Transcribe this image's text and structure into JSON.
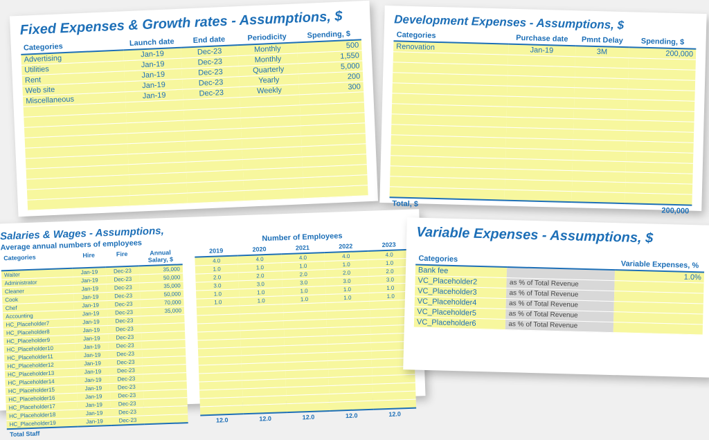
{
  "fixed": {
    "title": "Fixed Expenses & Growth rates - Assumptions, $",
    "headers": [
      "Categories",
      "Launch date",
      "End date",
      "Periodicity",
      "Spending, $"
    ],
    "rows": [
      {
        "cat": "Advertising",
        "launch": "Jan-19",
        "end": "Dec-23",
        "per": "Monthly",
        "spend": "500"
      },
      {
        "cat": "Utilities",
        "launch": "Jan-19",
        "end": "Dec-23",
        "per": "Monthly",
        "spend": "1,550"
      },
      {
        "cat": "Rent",
        "launch": "Jan-19",
        "end": "Dec-23",
        "per": "Quarterly",
        "spend": "5,000"
      },
      {
        "cat": "Web site",
        "launch": "Jan-19",
        "end": "Dec-23",
        "per": "Yearly",
        "spend": "200"
      },
      {
        "cat": "Miscellaneous",
        "launch": "Jan-19",
        "end": "Dec-23",
        "per": "Weekly",
        "spend": "300"
      }
    ],
    "blank_rows": 10
  },
  "dev": {
    "title": "Development Expenses - Assumptions, $",
    "headers": [
      "Categories",
      "Purchase date",
      "Pmnt Delay",
      "Spending, $"
    ],
    "rows": [
      {
        "cat": "Renovation",
        "date": "Jan-19",
        "delay": "3M",
        "spend": "200,000"
      }
    ],
    "blank_rows": 14,
    "total_label": "Total, $",
    "total_value": "200,000"
  },
  "sal": {
    "title": "Salaries & Wages - Assumptions,",
    "subtitle": "Average annual numbers of employees",
    "emp_title": "Number of Employees",
    "headers_left": [
      "Categories",
      "Hire",
      "Fire",
      "Annual Salary, $"
    ],
    "years": [
      "2019",
      "2020",
      "2021",
      "2022",
      "2023"
    ],
    "rows": [
      {
        "cat": "Waiter",
        "hire": "Jan-19",
        "fire": "Dec-23",
        "sal": "35,000",
        "y": [
          "4.0",
          "4.0",
          "4.0",
          "4.0",
          "4.0"
        ]
      },
      {
        "cat": "Administrator",
        "hire": "Jan-19",
        "fire": "Dec-23",
        "sal": "50,000",
        "y": [
          "1.0",
          "1.0",
          "1.0",
          "1.0",
          "1.0"
        ]
      },
      {
        "cat": "Cleaner",
        "hire": "Jan-19",
        "fire": "Dec-23",
        "sal": "35,000",
        "y": [
          "2.0",
          "2.0",
          "2.0",
          "2.0",
          "2.0"
        ]
      },
      {
        "cat": "Cook",
        "hire": "Jan-19",
        "fire": "Dec-23",
        "sal": "50,000",
        "y": [
          "3.0",
          "3.0",
          "3.0",
          "3.0",
          "3.0"
        ]
      },
      {
        "cat": "Chef",
        "hire": "Jan-19",
        "fire": "Dec-23",
        "sal": "70,000",
        "y": [
          "1.0",
          "1.0",
          "1.0",
          "1.0",
          "1.0"
        ]
      },
      {
        "cat": "Accounting",
        "hire": "Jan-19",
        "fire": "Dec-23",
        "sal": "35,000",
        "y": [
          "1.0",
          "1.0",
          "1.0",
          "1.0",
          "1.0"
        ]
      },
      {
        "cat": "HC_Placeholder7",
        "hire": "Jan-19",
        "fire": "Dec-23",
        "sal": "",
        "y": [
          "",
          "",
          "",
          "",
          ""
        ]
      },
      {
        "cat": "HC_Placeholder8",
        "hire": "Jan-19",
        "fire": "Dec-23",
        "sal": "",
        "y": [
          "",
          "",
          "",
          "",
          ""
        ]
      },
      {
        "cat": "HC_Placeholder9",
        "hire": "Jan-19",
        "fire": "Dec-23",
        "sal": "",
        "y": [
          "",
          "",
          "",
          "",
          ""
        ]
      },
      {
        "cat": "HC_Placeholder10",
        "hire": "Jan-19",
        "fire": "Dec-23",
        "sal": "",
        "y": [
          "",
          "",
          "",
          "",
          ""
        ]
      },
      {
        "cat": "HC_Placeholder11",
        "hire": "Jan-19",
        "fire": "Dec-23",
        "sal": "",
        "y": [
          "",
          "",
          "",
          "",
          ""
        ]
      },
      {
        "cat": "HC_Placeholder12",
        "hire": "Jan-19",
        "fire": "Dec-23",
        "sal": "",
        "y": [
          "",
          "",
          "",
          "",
          ""
        ]
      },
      {
        "cat": "HC_Placeholder13",
        "hire": "Jan-19",
        "fire": "Dec-23",
        "sal": "",
        "y": [
          "",
          "",
          "",
          "",
          ""
        ]
      },
      {
        "cat": "HC_Placeholder14",
        "hire": "Jan-19",
        "fire": "Dec-23",
        "sal": "",
        "y": [
          "",
          "",
          "",
          "",
          ""
        ]
      },
      {
        "cat": "HC_Placeholder15",
        "hire": "Jan-19",
        "fire": "Dec-23",
        "sal": "",
        "y": [
          "",
          "",
          "",
          "",
          ""
        ]
      },
      {
        "cat": "HC_Placeholder16",
        "hire": "Jan-19",
        "fire": "Dec-23",
        "sal": "",
        "y": [
          "",
          "",
          "",
          "",
          ""
        ]
      },
      {
        "cat": "HC_Placeholder17",
        "hire": "Jan-19",
        "fire": "Dec-23",
        "sal": "",
        "y": [
          "",
          "",
          "",
          "",
          ""
        ]
      },
      {
        "cat": "HC_Placeholder18",
        "hire": "Jan-19",
        "fire": "Dec-23",
        "sal": "",
        "y": [
          "",
          "",
          "",
          "",
          ""
        ]
      },
      {
        "cat": "HC_Placeholder19",
        "hire": "Jan-19",
        "fire": "Dec-23",
        "sal": "",
        "y": [
          "",
          "",
          "",
          "",
          ""
        ]
      }
    ],
    "total_label": "Total Staff",
    "totals": [
      "12.0",
      "12.0",
      "12.0",
      "12.0",
      "12.0"
    ]
  },
  "var": {
    "title": "Variable Expenses - Assumptions, $",
    "headers": [
      "Categories",
      "",
      "Variable Expenses, %"
    ],
    "basis": "as % of Total Revenue",
    "rows": [
      {
        "cat": "Bank fee",
        "pct": "1.0%"
      },
      {
        "cat": "VC_Placeholder2",
        "pct": ""
      },
      {
        "cat": "VC_Placeholder3",
        "pct": ""
      },
      {
        "cat": "VC_Placeholder4",
        "pct": ""
      },
      {
        "cat": "VC_Placeholder5",
        "pct": ""
      },
      {
        "cat": "VC_Placeholder6",
        "pct": ""
      }
    ]
  }
}
